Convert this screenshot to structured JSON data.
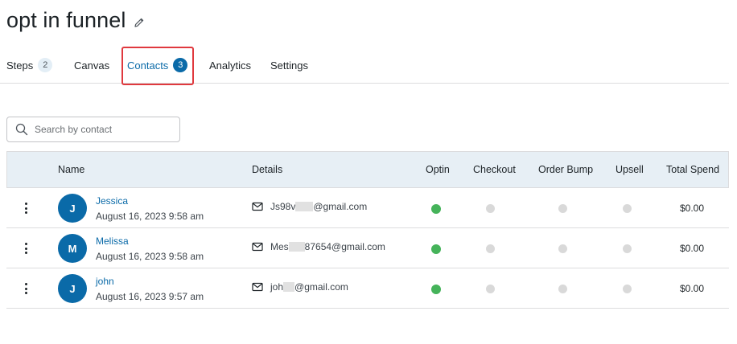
{
  "page": {
    "title": "opt in funnel"
  },
  "tabs": [
    {
      "label": "Steps",
      "badge": "2"
    },
    {
      "label": "Canvas"
    },
    {
      "label": "Contacts",
      "badge": "3",
      "active": true
    },
    {
      "label": "Analytics"
    },
    {
      "label": "Settings"
    }
  ],
  "search": {
    "placeholder": "Search by contact",
    "value": ""
  },
  "table": {
    "headers": [
      "Name",
      "Details",
      "Optin",
      "Checkout",
      "Order Bump",
      "Upsell",
      "Total Spend"
    ],
    "rows": [
      {
        "initial": "J",
        "name": "Jessica",
        "date": "August 16, 2023 9:58 am",
        "email_start": "Js98v",
        "email_end": "@gmail.com",
        "optin": true,
        "checkout": false,
        "order_bump": false,
        "upsell": false,
        "total": "$0.00"
      },
      {
        "initial": "M",
        "name": "Melissa",
        "date": "August 16, 2023 9:58 am",
        "email_start": "Mes",
        "email_end": "87654@gmail.com",
        "optin": true,
        "checkout": false,
        "order_bump": false,
        "upsell": false,
        "total": "$0.00"
      },
      {
        "initial": "J",
        "name": "john",
        "date": "August 16, 2023 9:57 am",
        "email_start": "joh",
        "email_end": "@gmail.com",
        "optin": true,
        "checkout": false,
        "order_bump": false,
        "upsell": false,
        "total": "$0.00"
      }
    ]
  },
  "colors": {
    "accent": "#0a6aa8",
    "status_on": "#45b35a",
    "status_off": "#d9d9d9",
    "highlight": "#e0393e"
  },
  "icons": {
    "edit": "pencil-icon",
    "search": "search-icon",
    "mail": "mail-icon",
    "menu": "kebab-menu-icon"
  }
}
